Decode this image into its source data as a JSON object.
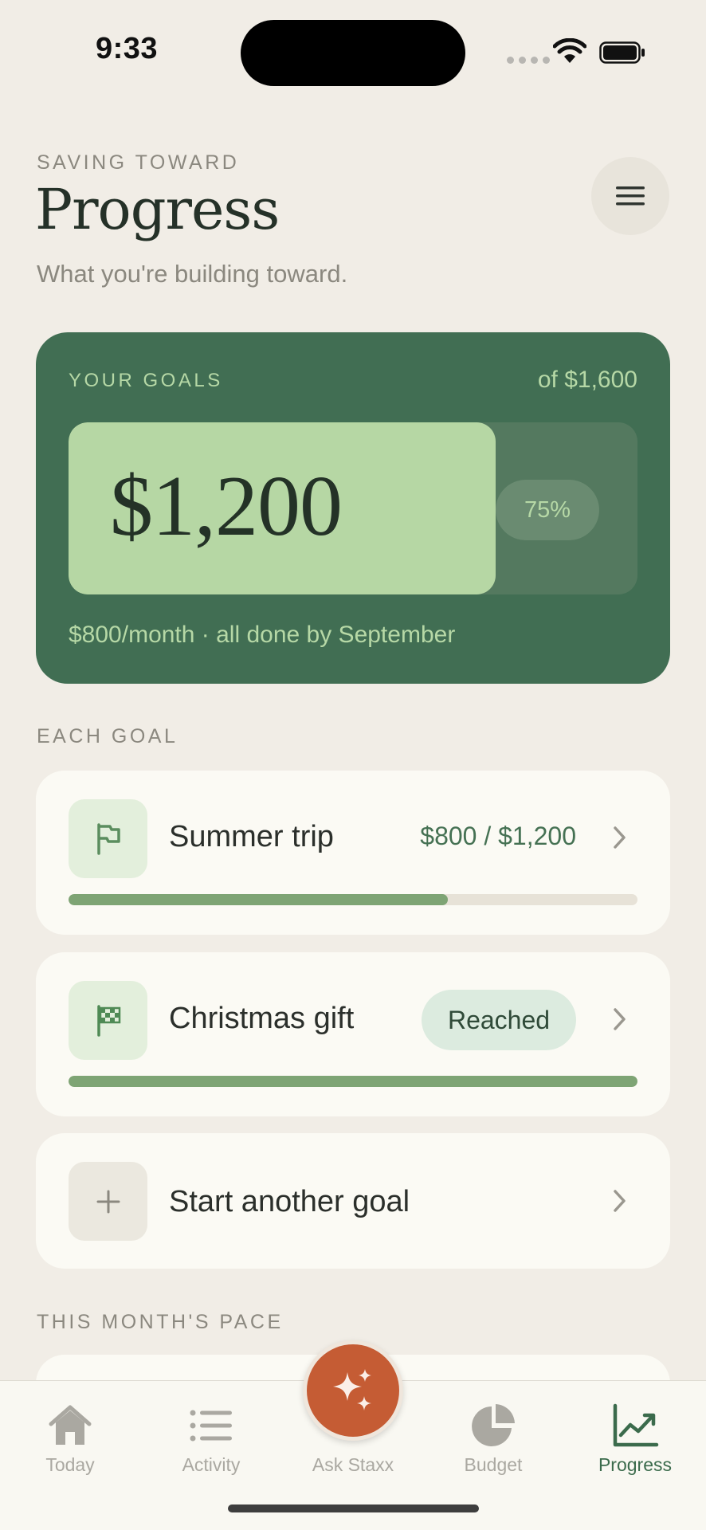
{
  "status_bar": {
    "time": "9:33"
  },
  "header": {
    "eyebrow": "SAVING TOWARD",
    "title": "Progress",
    "subtitle": "What you're building toward.",
    "menu_icon": "hamburger-icon"
  },
  "goals_summary": {
    "label": "YOUR GOALS",
    "total": "of $1,600",
    "amount": "$1,200",
    "percent_label": "75%",
    "progress": 0.75,
    "note": "$800/month · all done by September"
  },
  "sections": {
    "each_goal": "EACH GOAL",
    "pace": "THIS MONTH'S PACE"
  },
  "goals": [
    {
      "icon": "flag-icon",
      "name": "Summer trip",
      "amount": "$800 / $1,200",
      "progress": 0.667
    },
    {
      "icon": "checkered-flag-icon",
      "name": "Christmas gift",
      "badge": "Reached",
      "progress": 1.0
    },
    {
      "icon": "plus-icon",
      "name": "Start another goal"
    }
  ],
  "tabs": [
    {
      "label": "Today",
      "icon": "home-icon"
    },
    {
      "label": "Activity",
      "icon": "list-icon"
    },
    {
      "label": "Ask Staxx",
      "icon": "sparkle-icon"
    },
    {
      "label": "Budget",
      "icon": "pie-chart-icon"
    },
    {
      "label": "Progress",
      "icon": "trend-chart-icon",
      "active": true
    }
  ],
  "colors": {
    "background": "#f1ede6",
    "card_green": "#416e53",
    "accent_light_green": "#b6d7a4",
    "progress_green": "#7ea474",
    "ask_orange": "#c55c34",
    "active_tab": "#3b6b4c"
  }
}
